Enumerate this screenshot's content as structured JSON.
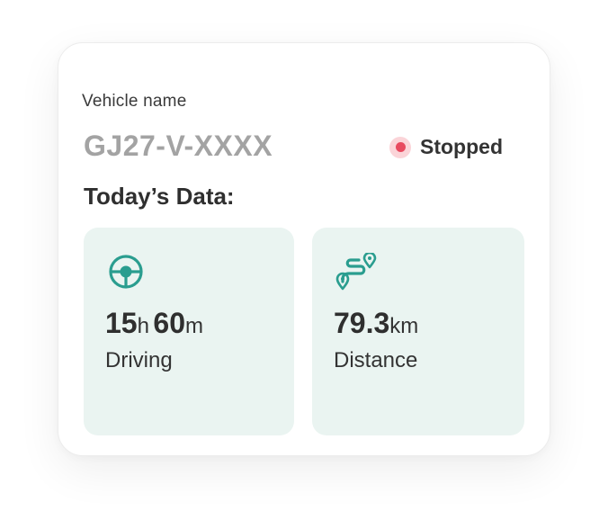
{
  "vehicle": {
    "label": "Vehicle name",
    "plate": "GJ27-V-XXXX",
    "status": "Stopped",
    "status_color": "#e84a5f"
  },
  "today": {
    "title": "Today’s Data:",
    "driving": {
      "icon": "steering-wheel-icon",
      "hours": "15",
      "hours_unit": "h",
      "minutes": "60",
      "minutes_unit": "m",
      "label": "Driving"
    },
    "distance": {
      "icon": "route-icon",
      "value": "79.3",
      "unit": "km",
      "label": "Distance"
    }
  },
  "colors": {
    "accent": "#2a9d8f",
    "tile_bg": "#eaf4f1"
  }
}
